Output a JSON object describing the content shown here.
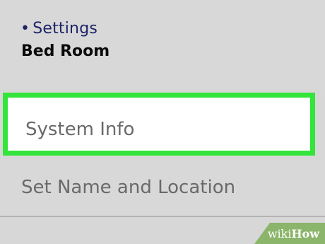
{
  "header": {
    "breadcrumb_bullet": "•",
    "breadcrumb": "Settings",
    "title": "Bed Room"
  },
  "menu": {
    "items": [
      {
        "label": "System Info"
      },
      {
        "label": "Set Name and Location"
      }
    ]
  },
  "watermark": {
    "text_wiki": "wiki",
    "text_how": "How"
  },
  "colors": {
    "highlight": "#33e53a",
    "breadcrumb": "#1c2366",
    "background": "#d7d7d7"
  }
}
